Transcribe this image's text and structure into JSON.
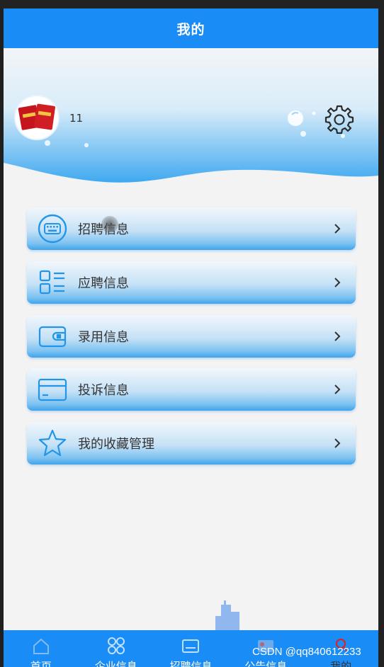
{
  "header": {
    "title": "我的"
  },
  "profile": {
    "username": "11",
    "avatar_icon": "red-envelope-avatar",
    "settings_icon": "gear-icon"
  },
  "menu": [
    {
      "label": "招聘信息",
      "icon": "keyboard-icon"
    },
    {
      "label": "应聘信息",
      "icon": "list-icon"
    },
    {
      "label": "录用信息",
      "icon": "wallet-icon"
    },
    {
      "label": "投诉信息",
      "icon": "card-icon"
    },
    {
      "label": "我的收藏管理",
      "icon": "star-icon"
    }
  ],
  "tabbar": {
    "items": [
      {
        "label": "首页",
        "icon": "home-icon"
      },
      {
        "label": "企业信息",
        "icon": "grid-icon"
      },
      {
        "label": "招聘信息",
        "icon": "keyboard-icon"
      },
      {
        "label": "公告信息",
        "icon": "notice-icon"
      },
      {
        "label": "我的",
        "icon": "user-icon"
      }
    ]
  },
  "watermark": "CSDN @qq840612233",
  "colors": {
    "primary": "#1a8cf5",
    "background": "#f3f3f3",
    "menu_icon": "#2196e8",
    "active_tab": "#e02020"
  }
}
